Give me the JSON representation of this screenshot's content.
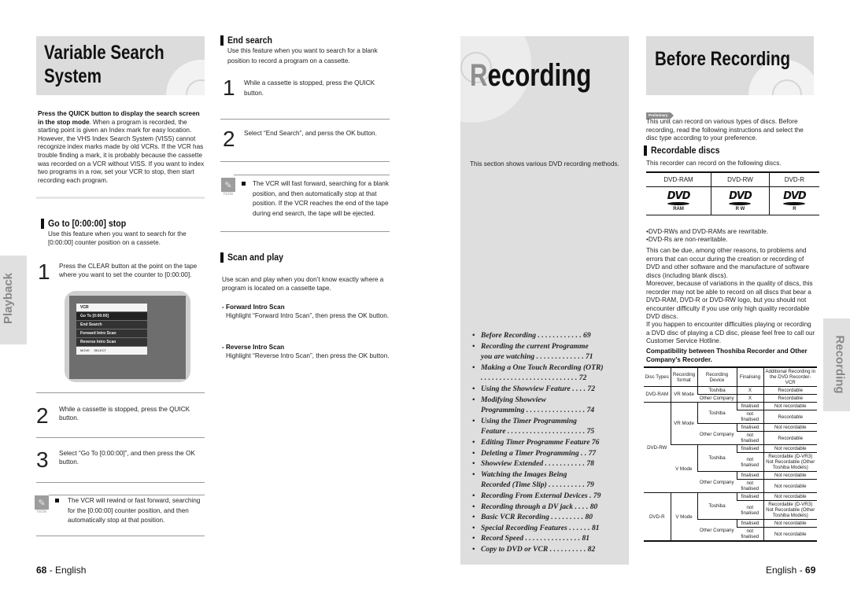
{
  "left_page": {
    "title_line1": "Variable Search",
    "title_line2": "System",
    "intro_bold": "Press the QUICK button to display the search screen in the stop mode",
    "intro_text": ". When a program is recorded, the starting point is given an Index mark for easy location. However, the VHS Index Search System (VISS) cannot recognize index marks made by old VCRs. If the VCR has trouble finding a mark, it is probably because the cassette was recorded on a VCR without VISS. If you want to index two programs in a row, set your VCR to stop, then start recording each program.",
    "goto_section": {
      "title": "Go to [0:00:00] stop",
      "desc": "Use this feature when you want to search for the [0:00:00] counter position on a cassete.",
      "steps": [
        {
          "num": "1",
          "text": "Press the CLEAR button at the point on the tape where you want to set the counter to [0:00:00]."
        },
        {
          "num": "2",
          "text": "While a cassette is stopped, press the QUICK button."
        },
        {
          "num": "3",
          "text": "Select “Go To  [0:00:00]”, and then press the OK button."
        }
      ],
      "note_label": "Note",
      "note_text": "The VCR will rewind or fast forward, searching for the [0:00:00] counter position, and then automatically stop at that position."
    },
    "osd_menu": {
      "header": "VCR",
      "items": [
        "Go To [0:00:00]",
        "End Search",
        "Forward Intro Scan",
        "Reverse Intro Scan"
      ],
      "footer_left": "MOVE",
      "footer_right": "SELECT"
    },
    "side_tab": "Playback",
    "end_search": {
      "title": "End search",
      "desc": "Use this feature when you want to search for a blank position to record a program on a cassette.",
      "steps": [
        {
          "num": "1",
          "text": "While a cassette is stopped, press the QUICK button."
        },
        {
          "num": "2",
          "text": "Select “End Search”, and perss the OK button."
        }
      ],
      "note_label": "Note",
      "note_text": "The VCR will fast forward, searching for a blank position, and then automatically stop at that position. If the VCR reaches the end of the tape during end search, the tape will be ejected."
    },
    "scan_play": {
      "title": "Scan and play",
      "desc": "Use scan and play when you don’t know exactly where a program is located on a cassette tape.",
      "forward_title": "- Forward Intro Scan",
      "forward_text": "Highlight “Forward Intro Scan”, then press the OK button.",
      "reverse_title": "- Reverse Intro Scan",
      "reverse_text": "Highlight “Reverse Intro Scan”, then press the OK button."
    },
    "footer_page": "68",
    "footer_lang": " - English"
  },
  "chapter": {
    "title_first": "R",
    "title_rest": "ecording",
    "intro": "This section shows various DVD recording methods.",
    "contents": [
      {
        "text": "Before Recording  . . . . . . . . . . . . 69"
      },
      {
        "text": "Recording the current Programme"
      },
      {
        "text": "you are watching . . . . . . . . . . . . . 71",
        "cont": true
      },
      {
        "text": "Making a One Touch Recording (OTR)"
      },
      {
        "text": ". . . . . . . . . . . . . . . . . . . . . . . . . . 72",
        "cont": true
      },
      {
        "text": "Using the Showview Feature  . . . . 72"
      },
      {
        "text": "Modifying Showview"
      },
      {
        "text": "Programming . . . . . . . . . . . . . . . . 74",
        "cont": true
      },
      {
        "text": "Using the Timer Programming"
      },
      {
        "text": "Feature . . . . . . . . . . . . . . . . . . . . . 75",
        "cont": true
      },
      {
        "text": "Editing Timer Programme Feature  76"
      },
      {
        "text": "Deleting a Timer Programming  . . 77"
      },
      {
        "text": "Showview Extended  . . . . . . . . . . . 78"
      },
      {
        "text": "Watching the Images Being"
      },
      {
        "text": "Recorded (Time Slip) . . . . . . . . . . 79",
        "cont": true
      },
      {
        "text": "Recording From External Devices . 79"
      },
      {
        "text": "Recording through a DV jack . . . . 80"
      },
      {
        "text": "Basic VCR Recording  . . . . . . . . . 80"
      },
      {
        "text": "Special Recording Features . . . . . . 81"
      },
      {
        "text": "Record Speed  . . . . . . . . . . . . . . . 81"
      },
      {
        "text": "Copy to DVD or VCR . . . . . . . . . . 82"
      }
    ]
  },
  "right_page": {
    "title": "Before Recording",
    "prelim_tag": "Preliminary",
    "intro": "This unit can record on various types of discs. Before recording, read the following instructions and select the disc type according to your preference.",
    "recordable": {
      "title": "Recordable discs",
      "desc": "This recorder can record on the following discs.",
      "disc_headers": [
        "DVD-RAM",
        "DVD-RW",
        "DVD-R"
      ],
      "disc_logo_text": "DVD",
      "disc_logo_subs": [
        "RAM",
        "R W",
        "R"
      ],
      "notes": [
        "•DVD-RWs and DVD-RAMs are rewritable.",
        "•DVD-Rs are non-rewritable."
      ]
    },
    "para1": "This can be due, among other reasons, to problems and errors that can occur during the creation or recording of DVD and other software and the manufacture of software discs (including blank discs).",
    "para2": "Moreover, because of variations in the quality of discs, this recorder may not be able to record on all discs that bear a DVD-RAM, DVD-R or DVD-RW logo, but you should not encounter difficulty if you use only high quality recordable DVD discs.",
    "para3": "If you happen to encounter difficulties playing or recording a DVD disc of playing a CD disc, please feel free to call our Customer Service Hotline.",
    "compat_title": "Compatibility between Thoshiba Recorder and Other Company’s Recorder.",
    "compat_headers": [
      "Disc Types",
      "Recording format",
      "Recording Device",
      "Finalising",
      "Additional Recording in the DVD Recorder-VCR"
    ],
    "compat": {
      "ram_disc": "DVD-RAM",
      "ram_format": "VR Mode",
      "ram_rows": [
        {
          "device": "Toshiba",
          "final": "X",
          "result": "Recordable"
        },
        {
          "device": "Other Company",
          "final": "X",
          "result": "Recordable"
        }
      ],
      "rw_disc": "DVD-RW",
      "rw_vr_format": "VR Mode",
      "rw_vr_toshiba": "Toshiba",
      "rw_vr_toshiba_rows": [
        {
          "final": "finalised",
          "result": "Not recordable"
        },
        {
          "final": "not finalised",
          "result": "Recordable"
        }
      ],
      "rw_vr_other": "Other Company",
      "rw_vr_other_rows": [
        {
          "final": "finalised",
          "result": "Not recordable"
        },
        {
          "final": "not finalised",
          "result": "Recordable"
        }
      ],
      "rw_v_format": "V Mode",
      "rw_v_toshiba": "Toshiba",
      "rw_v_toshiba_rows": [
        {
          "final": "finalised",
          "result": "Not recordable"
        },
        {
          "final": "not finalised",
          "result": "Recordable (D-VR3) Not Recordable (Other Toshiba Models)"
        }
      ],
      "rw_v_other": "Other Company",
      "rw_v_other_rows": [
        {
          "final": "finalised",
          "result": "Not recordable"
        },
        {
          "final": "not finalised",
          "result": "Not recordable"
        }
      ],
      "r_disc": "DVD-R",
      "r_format": "V Mode",
      "r_toshiba": "Toshiba",
      "r_toshiba_rows": [
        {
          "final": "finalised",
          "result": "Not recordable"
        },
        {
          "final": "not finalised",
          "result": "Recordable (D-VR3) Not Recordable (Other Toshiba Models)"
        }
      ],
      "r_other": "Other Company",
      "r_other_rows": [
        {
          "final": "finalised",
          "result": "Not recordable"
        },
        {
          "final": "not finalised",
          "result": "Not recordable"
        }
      ]
    },
    "side_tab": "Recording",
    "footer_lang": "English - ",
    "footer_page": "69"
  }
}
